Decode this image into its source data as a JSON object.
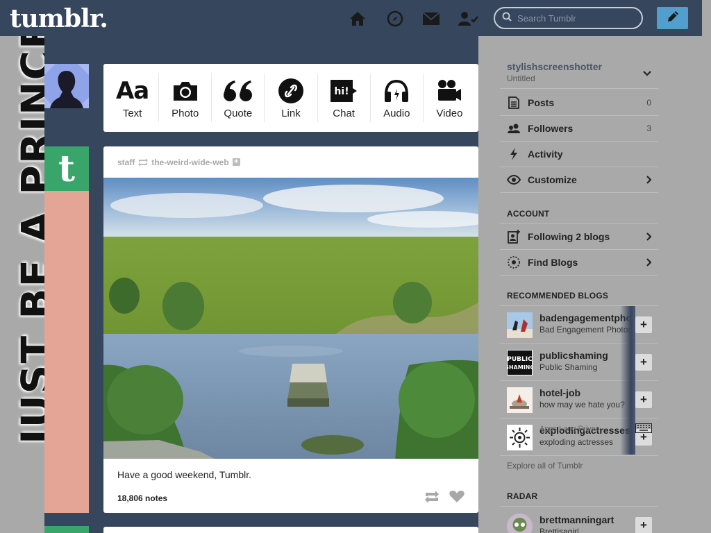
{
  "header": {
    "logo": "tumblr.",
    "search_placeholder": "Search Tumblr",
    "nav_icons": [
      "home-icon",
      "explore-icon",
      "inbox-icon",
      "account-icon"
    ],
    "compose_icon": "pencil-icon",
    "bg_color": "#36465d",
    "compose_color": "#529ecc"
  },
  "background": {
    "theme_text": "JUST BE A PRINCESS"
  },
  "post_types": [
    {
      "label": "Text",
      "icon": "text-icon"
    },
    {
      "label": "Photo",
      "icon": "camera-icon"
    },
    {
      "label": "Quote",
      "icon": "quote-icon"
    },
    {
      "label": "Link",
      "icon": "link-icon"
    },
    {
      "label": "Chat",
      "icon": "chat-icon"
    },
    {
      "label": "Audio",
      "icon": "headphones-icon"
    },
    {
      "label": "Video",
      "icon": "video-camera-icon"
    }
  ],
  "post": {
    "author": "staff",
    "reblogged_from": "the-weird-wide-web",
    "caption": "Have a good weekend, Tumblr.",
    "notes": "18,806 notes",
    "image_description": "Animated landscape of a boat on a river with green fields"
  },
  "sidebar": {
    "blog": {
      "name": "stylishscreenshotter",
      "title": "Untitled"
    },
    "items": [
      {
        "label": "Posts",
        "count": "0",
        "icon": "posts-icon"
      },
      {
        "label": "Followers",
        "count": "3",
        "icon": "followers-icon"
      },
      {
        "label": "Activity",
        "count": "",
        "icon": "activity-icon"
      },
      {
        "label": "Customize",
        "count": "",
        "icon": "eye-icon"
      }
    ],
    "account_title": "ACCOUNT",
    "account_items": [
      {
        "label": "Following 2 blogs",
        "icon": "following-icon"
      },
      {
        "label": "Find Blogs",
        "icon": "find-blogs-icon"
      }
    ],
    "recommended_title": "RECOMMENDED BLOGS",
    "recommended": [
      {
        "name": "badengagementphotos",
        "desc": "Bad Engagement Photos"
      },
      {
        "name": "publicshaming",
        "desc": "Public Shaming"
      },
      {
        "name": "hotel-job",
        "desc": "how may we hate you?"
      },
      {
        "name": "explodingactresses",
        "desc": "exploding actresses"
      }
    ],
    "explore": "Explore all of Tumblr",
    "radar_title": "RADAR",
    "radar": {
      "name": "brettmanningart",
      "desc": "Brettisagirl"
    },
    "ghost_text": "Apps   Lang   Prives"
  },
  "avatar_logos": {
    "public_shaming": "PUBLIC SHAMING",
    "tumblr_t": "t"
  }
}
